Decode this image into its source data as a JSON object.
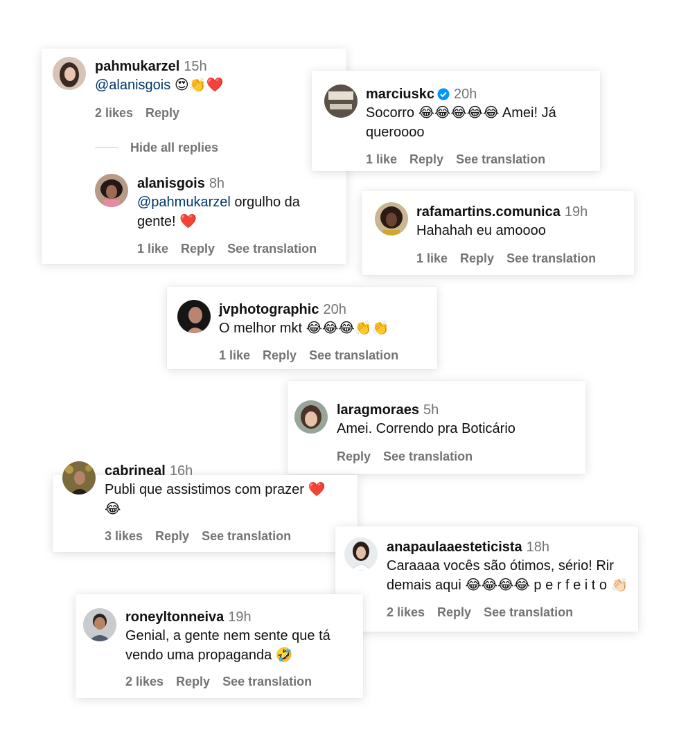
{
  "comments": {
    "pahmukarzel": {
      "user": "pahmukarzel",
      "time": "15h",
      "mention": "@alanisgois",
      "emoji": "😍👏❤️",
      "likes": "2 likes",
      "reply": "Reply"
    },
    "hide_replies": "Hide all replies",
    "alanisgois": {
      "user": "alanisgois",
      "time": "8h",
      "mention": "@pahmukarzel",
      "text_a": " orgulho da",
      "text_b": "gente! ❤️",
      "likes": "1 like",
      "reply": "Reply",
      "translate": "See translation"
    },
    "marciuskc": {
      "user": "marciuskc",
      "time": "20h",
      "text_a": "Socorro 😂😂😂😂😂 Amei! Já",
      "text_b": "queroooo",
      "likes": "1 like",
      "reply": "Reply",
      "translate": "See translation"
    },
    "rafamartins": {
      "user": "rafamartins.comunica",
      "time": "19h",
      "text_a": "Hahahah eu amoooo",
      "likes": "1 like",
      "reply": "Reply",
      "translate": "See translation"
    },
    "jvphotographic": {
      "user": "jvphotographic",
      "time": "20h",
      "text_a": "O melhor mkt 😂😂😂👏👏",
      "likes": "1 like",
      "reply": "Reply",
      "translate": "See translation"
    },
    "laragmoraes": {
      "user": "laragmoraes",
      "time": "5h",
      "text_a": "Amei. Correndo pra Boticário",
      "reply": "Reply",
      "translate": "See translation"
    },
    "cabrineal": {
      "user": "cabrineal",
      "time": "16h",
      "text_a": "Publi que assistimos com prazer ❤️",
      "text_b": "😂",
      "likes": "3 likes",
      "reply": "Reply",
      "translate": "See translation"
    },
    "anapaula": {
      "user": "anapaulaaesteticista",
      "time": "18h",
      "text_a": "Caraaaa vocês são ótimos, sério! Rir",
      "text_b": "demais aqui 😂😂😂😂 p e r f e i t o 👏🏻",
      "likes": "2 likes",
      "reply": "Reply",
      "translate": "See translation"
    },
    "roneyltonneiva": {
      "user": "roneyltonneiva",
      "time": "19h",
      "text_a": "Genial, a gente nem sente que tá",
      "text_b": "vendo uma propaganda 🤣",
      "likes": "2 likes",
      "reply": "Reply",
      "translate": "See translation"
    }
  },
  "colors": {
    "username": "#111111",
    "meta": "#737373",
    "mention": "#00376b",
    "verified": "#0095f6"
  }
}
